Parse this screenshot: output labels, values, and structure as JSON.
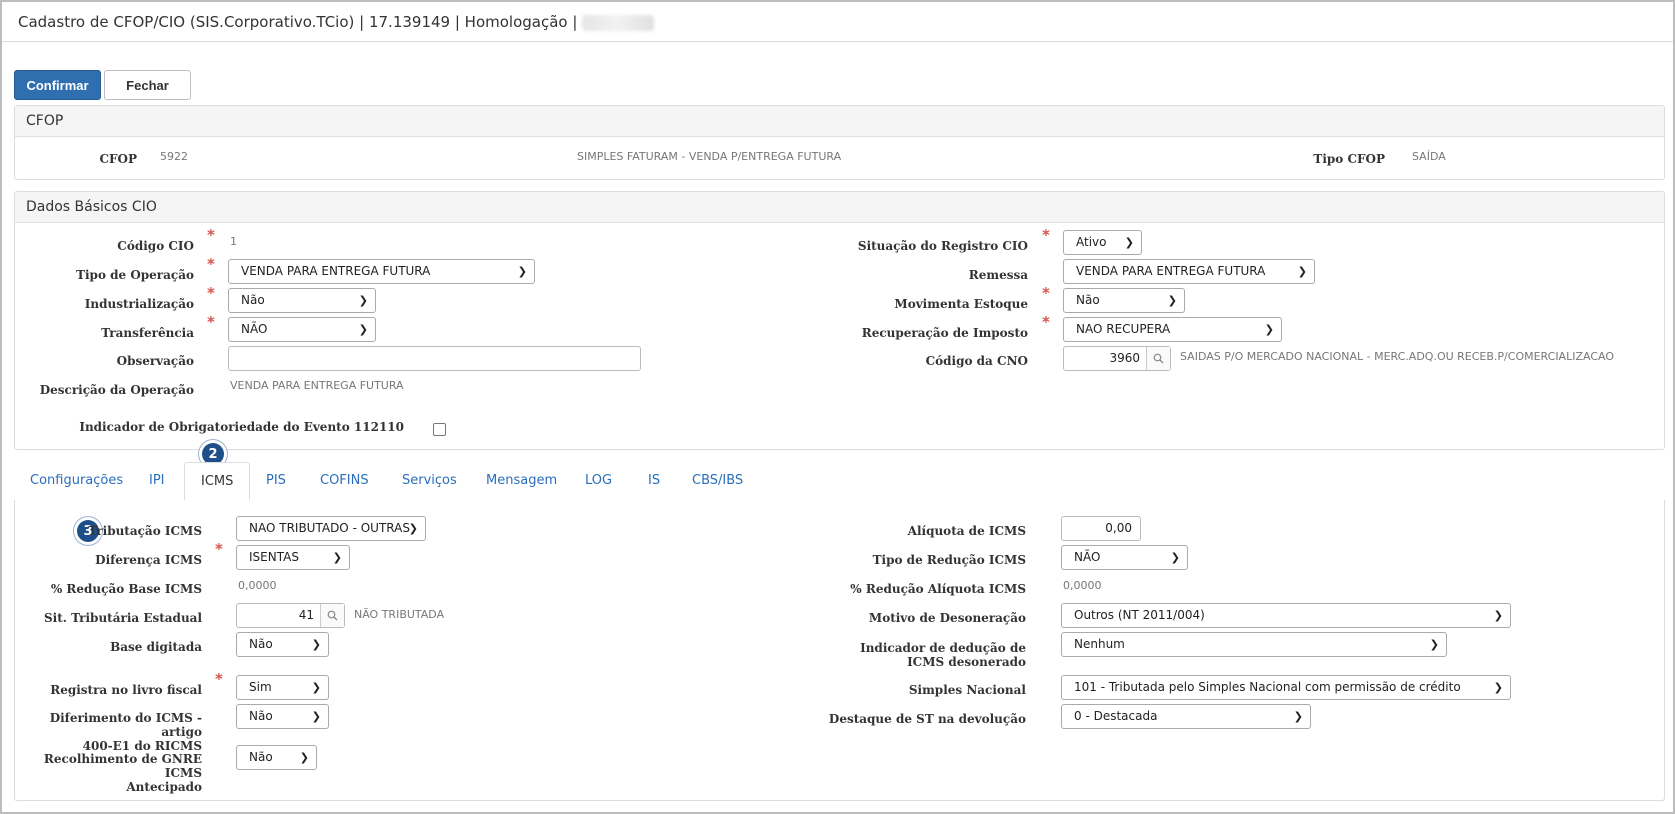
{
  "window": {
    "title": "Cadastro de CFOP/CIO (SIS.Corporativo.TCio) | 17.139149 | Homologação | "
  },
  "toolbar": {
    "confirm_label": "Confirmar",
    "close_label": "Fechar"
  },
  "cfop_panel": {
    "title": "CFOP",
    "cfop_label": "CFOP",
    "cfop_code": "5922",
    "cfop_description": "SIMPLES FATURAM - VENDA P/ENTREGA FUTURA",
    "tipo_label": "Tipo CFOP",
    "tipo_value": "SAÍDA"
  },
  "basic_panel": {
    "title": "Dados Básicos CIO",
    "codigo_cio": {
      "label": "Código CIO",
      "value": "1"
    },
    "tipo_operacao": {
      "label": "Tipo de Operação",
      "value": "VENDA PARA ENTREGA FUTURA"
    },
    "industrializacao": {
      "label": "Industrialização",
      "value": "Não"
    },
    "transferencia": {
      "label": "Transferência",
      "value": "NÃO"
    },
    "observacao": {
      "label": "Observação",
      "value": ""
    },
    "descricao_operacao": {
      "label": "Descrição da Operação",
      "value": "VENDA PARA ENTREGA FUTURA"
    },
    "indicador_evento": {
      "label": "Indicador de Obrigatoriedade do Evento 112110"
    },
    "situacao_registro": {
      "label": "Situação do Registro CIO",
      "value": "Ativo"
    },
    "remessa": {
      "label": "Remessa",
      "value": "VENDA PARA ENTREGA FUTURA"
    },
    "movimenta_estoque": {
      "label": "Movimenta Estoque",
      "value": "Não"
    },
    "recuperacao_imposto": {
      "label": "Recuperação de Imposto",
      "value": "NAO RECUPERA"
    },
    "codigo_cno": {
      "label": "Código da CNO",
      "value": "3960",
      "description": "SAIDAS P/O MERCADO NACIONAL - MERC.ADQ.OU RECEB.P/COMERCIALIZACAO"
    }
  },
  "tabs": [
    "Configurações",
    "IPI",
    "ICMS",
    "PIS",
    "COFINS",
    "Serviços",
    "Mensagem",
    "LOG",
    "IS",
    "CBS/IBS"
  ],
  "badges": {
    "tab_marker": "2",
    "field_marker": "3"
  },
  "icms": {
    "tributacao": {
      "label": "Tributação ICMS",
      "value": "NAO TRIBUTADO - OUTRAS"
    },
    "diferenca": {
      "label": "Diferença ICMS",
      "value": "ISENTAS"
    },
    "reducao_base": {
      "label": "% Redução Base ICMS",
      "value": "0,0000"
    },
    "sit_tributaria": {
      "label": "Sit. Tributária Estadual",
      "value": "41",
      "description": "NÃO TRIBUTADA"
    },
    "base_digitada": {
      "label": "Base digitada",
      "value": "Não"
    },
    "registra_livro": {
      "label": "Registra no livro fiscal",
      "value": "Sim"
    },
    "diferimento_line1": "Diferimento do ICMS - artigo",
    "diferimento_line2": "400-E1 do RICMS",
    "diferimento_value": "Não",
    "recolhimento_line1": "Recolhimento de GNRE ICMS",
    "recolhimento_line2": "Antecipado",
    "recolhimento_value": "Não",
    "aliquota": {
      "label": "Alíquota de ICMS",
      "value": "0,00"
    },
    "tipo_reducao": {
      "label": "Tipo de Redução ICMS",
      "value": "NÃO"
    },
    "reducao_aliquota": {
      "label": "% Redução Alíquota ICMS",
      "value": "0,0000"
    },
    "motivo_desoneracao": {
      "label": "Motivo de Desoneração",
      "value": "Outros (NT 2011/004)"
    },
    "indicador_deducao_line1": "Indicador de dedução de",
    "indicador_deducao_line2": "ICMS desonerado",
    "indicador_deducao_value": "Nenhum",
    "simples_nacional": {
      "label": "Simples Nacional",
      "value": "101 - Tributada pelo Simples Nacional com permissão de crédito"
    },
    "destaque_st": {
      "label": "Destaque de ST na devolução",
      "value": "0 - Destacada"
    }
  }
}
